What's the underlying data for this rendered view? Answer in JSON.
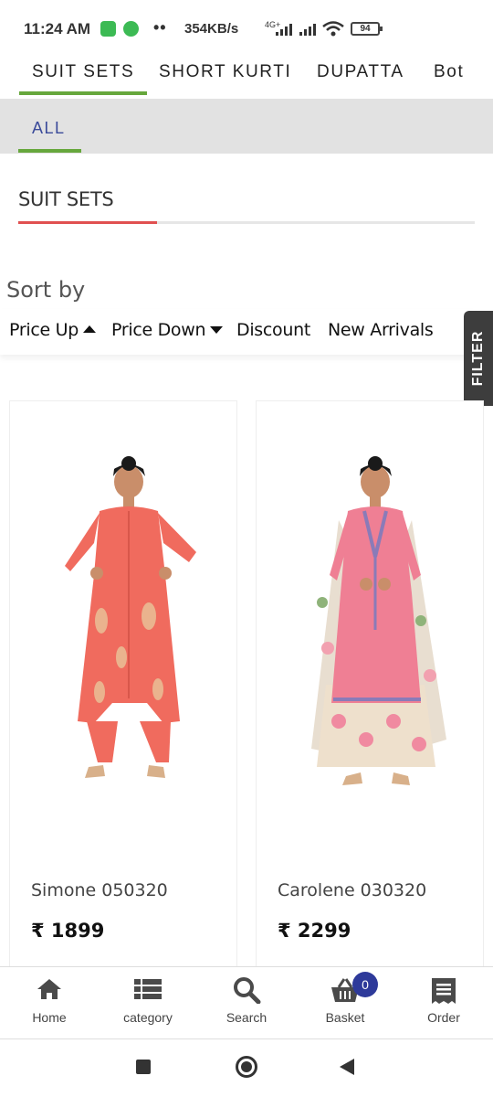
{
  "status_bar": {
    "time": "11:24 AM",
    "speed": "354KB/s",
    "network": "4G+",
    "battery": "94"
  },
  "category_tabs": [
    {
      "label": "SUIT SETS",
      "active": true
    },
    {
      "label": "SHORT KURTI",
      "active": false
    },
    {
      "label": "DUPATTA",
      "active": false
    },
    {
      "label": "Bot",
      "active": false
    }
  ],
  "sub_tabs": [
    {
      "label": "ALL",
      "active": true
    }
  ],
  "section": {
    "title": "SUIT SETS"
  },
  "sort": {
    "label": "Sort by",
    "options": [
      {
        "label": "Price Up",
        "indicator": "up"
      },
      {
        "label": "Price Down",
        "indicator": "down"
      },
      {
        "label": "Discount"
      },
      {
        "label": "New Arrivals"
      }
    ]
  },
  "filter": {
    "label": "FILTER"
  },
  "products": [
    {
      "name": "Simone 050320",
      "price": "₹ 1899",
      "color": "#f06b5e"
    },
    {
      "name": "Carolene 030320",
      "price": "₹ 2299",
      "color": "#ef7f94"
    }
  ],
  "bottom_nav": {
    "items": [
      {
        "label": "Home",
        "icon": "home-icon"
      },
      {
        "label": "category",
        "icon": "list-icon"
      },
      {
        "label": "Search",
        "icon": "search-icon"
      },
      {
        "label": "Basket",
        "icon": "basket-icon",
        "badge": "0"
      },
      {
        "label": "Order",
        "icon": "receipt-icon"
      }
    ]
  },
  "colors": {
    "accent_green": "#66a73c",
    "accent_red": "#e05050",
    "sub_tab_text": "#3a4a9a",
    "badge": "#2e3a9a"
  }
}
